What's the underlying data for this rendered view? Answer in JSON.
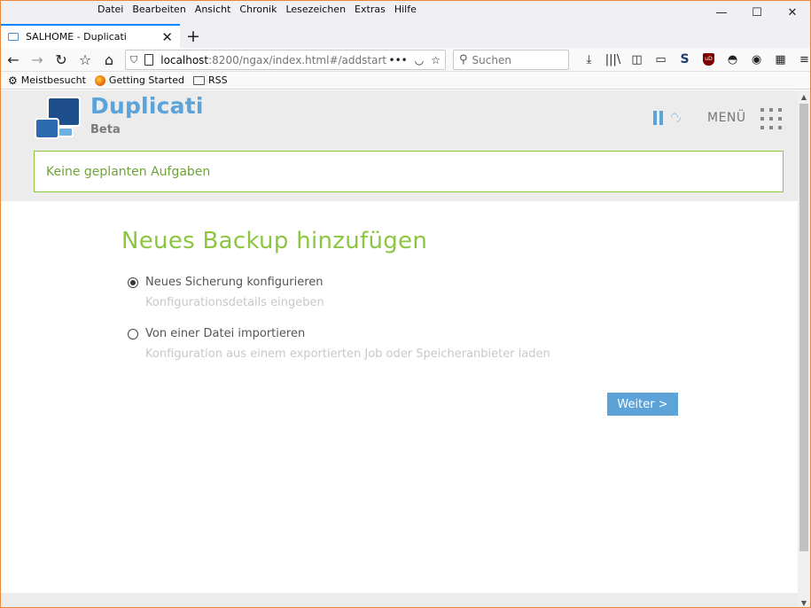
{
  "window": {
    "menu": [
      "Datei",
      "Bearbeiten",
      "Ansicht",
      "Chronik",
      "Lesezeichen",
      "Extras",
      "Hilfe"
    ],
    "controls": {
      "minimize": "—",
      "maximize": "☐",
      "close": "✕"
    }
  },
  "tabs": [
    {
      "title": "SALHOME - Duplicati",
      "close": "✕"
    }
  ],
  "newtab": "+",
  "nav": {
    "back": "←",
    "forward": "→",
    "reload": "↻",
    "bookmark_page": "☆",
    "home": "⌂",
    "url_host": "localhost",
    "url_path": ":8200/ngax/index.html#/addstart",
    "page_actions": "•••",
    "pocket": "◡",
    "star": "☆",
    "search_placeholder": "Suchen",
    "search_icon": "⚲"
  },
  "toolbar_icons": {
    "download": "⤓",
    "library": "|||\\",
    "sidebar": "◫",
    "reader": "▭",
    "s_ext": "S",
    "ublock": "uD",
    "mask": "◓",
    "account": "◉",
    "grid_ext": "▦",
    "hamburger": "≡"
  },
  "bookmarks": [
    {
      "label": "Meistbesucht",
      "icon": "gear-icon"
    },
    {
      "label": "Getting Started",
      "icon": "firefox-icon"
    },
    {
      "label": "RSS",
      "icon": "folder-icon"
    }
  ],
  "app": {
    "brand": "Duplicati",
    "sub": "Beta",
    "menu_label": "MENÜ",
    "notice": "Keine geplanten Aufgaben",
    "throttle_glyph": "◜◝◞",
    "colors": {
      "accent_blue": "#5ba3d9",
      "accent_green": "#8cc63f",
      "logo_dark": "#1f4e8c"
    }
  },
  "page": {
    "title": "Neues Backup hinzufügen",
    "options": [
      {
        "label": "Neues Sicherung konfigurieren",
        "desc": "Konfigurationsdetails eingeben",
        "selected": true
      },
      {
        "label": "Von einer Datei importieren",
        "desc": "Konfiguration aus einem exportierten Job oder Speicheranbieter laden",
        "selected": false
      }
    ],
    "next_button": "Weiter >"
  },
  "scroll": {
    "up": "▲",
    "down": "▼"
  }
}
